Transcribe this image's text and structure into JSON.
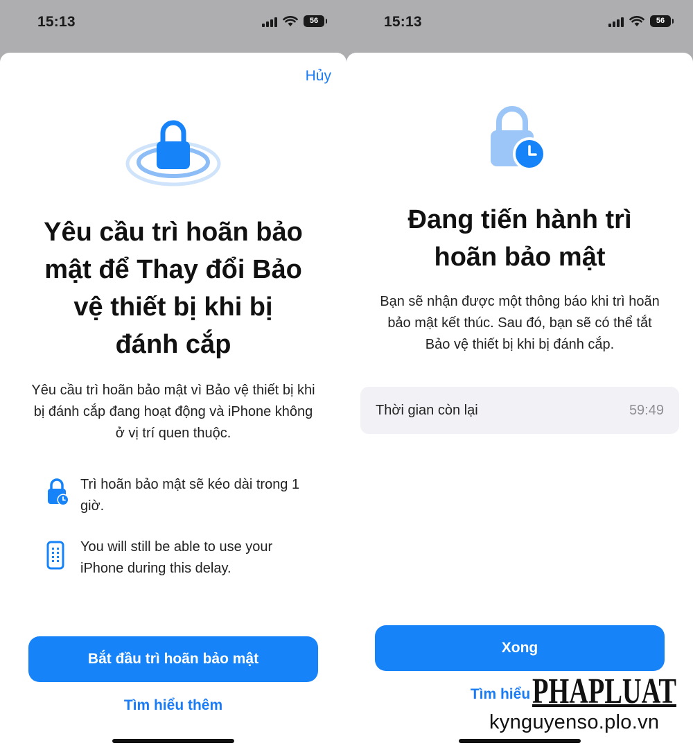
{
  "left": {
    "status": {
      "time": "15:13",
      "battery": "56"
    },
    "cancel_label": "Hủy",
    "title_lines": [
      "Yêu cầu trì hoãn bảo",
      "mật để Thay đổi Bảo",
      "vệ thiết bị khi bị",
      "đánh cắp"
    ],
    "subtitle": "Yêu cầu trì hoãn bảo mật vì Bảo vệ thiết bị khi bị đánh cắp đang hoạt động và iPhone không ở vị trí quen thuộc.",
    "features": [
      {
        "icon": "lock-clock-icon",
        "text": "Trì hoãn bảo mật sẽ kéo dài trong 1 giờ."
      },
      {
        "icon": "iphone-icon",
        "text": "You will still be able to use your iPhone during this delay."
      }
    ],
    "primary_button": "Bắt đầu trì hoãn bảo mật",
    "secondary_link": "Tìm hiểu thêm"
  },
  "right": {
    "status": {
      "time": "15:13",
      "battery": "56"
    },
    "title_lines": [
      "Đang tiến hành trì",
      "hoãn bảo mật"
    ],
    "subtitle": "Bạn sẽ nhận được một thông báo khi trì hoãn bảo mật kết thúc. Sau đó, bạn sẽ có thể tắt Bảo vệ thiết bị khi bị đánh cắp.",
    "info_label": "Thời gian còn lại",
    "info_value": "59:49",
    "primary_button": "Xong",
    "secondary_link": "Tìm hiểu thêm"
  },
  "watermark": {
    "logo_text": "PHAPLUAT",
    "url": "kynguyenso.plo.vn"
  },
  "colors": {
    "accent": "#1683f8",
    "link": "#1a7cf5",
    "backdrop": "#aeaeb0"
  }
}
